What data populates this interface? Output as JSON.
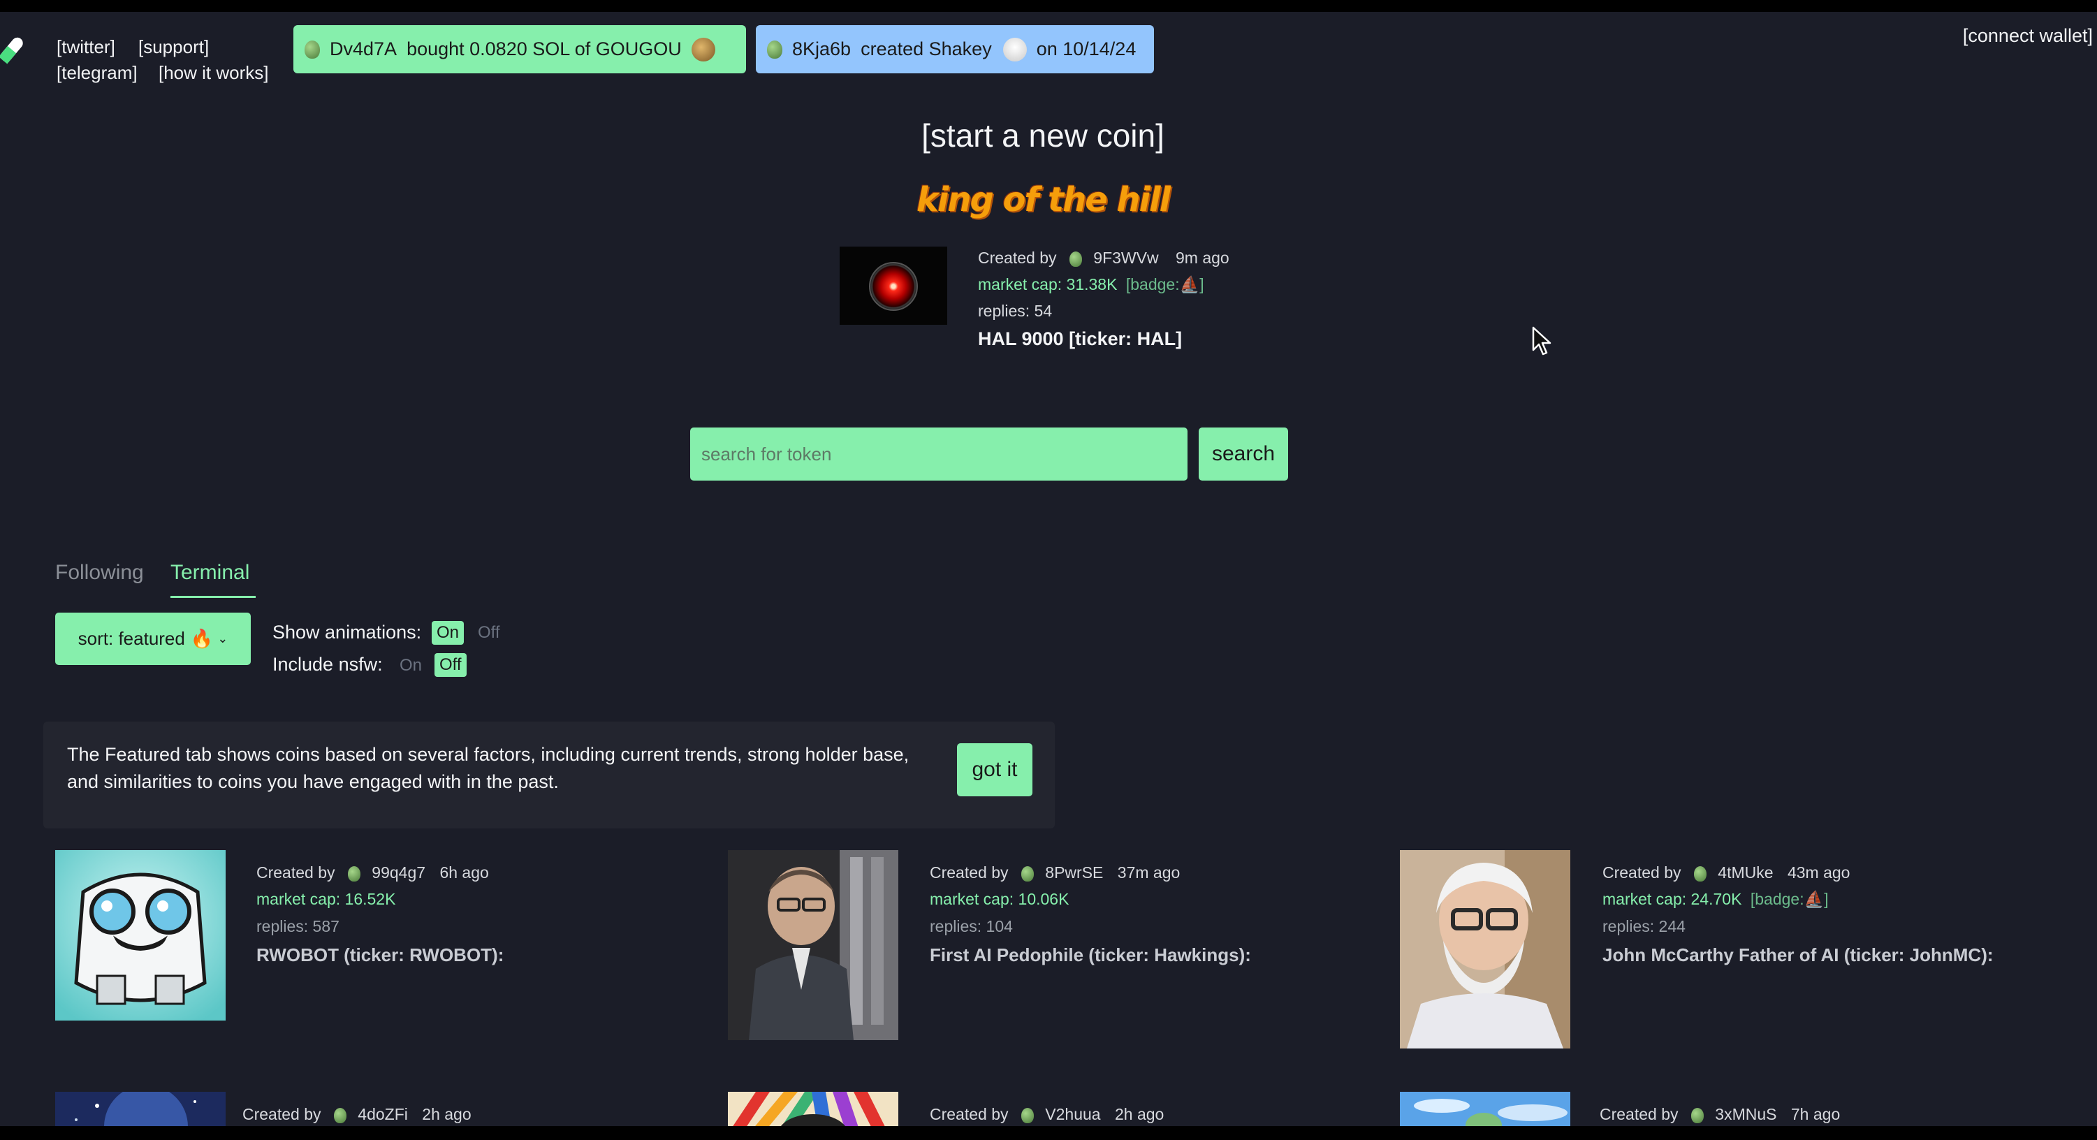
{
  "nav": {
    "twitter": "[twitter]",
    "support": "[support]",
    "telegram": "[telegram]",
    "how_it_works": "[how it works]",
    "connect_wallet": "[connect wallet]"
  },
  "ticker": {
    "buy": {
      "user": "Dv4d7A",
      "text": "bought 0.0820 SOL of GOUGOU"
    },
    "create": {
      "user": "8Kja6b",
      "text": "created Shakey",
      "date": "on 10/14/24"
    }
  },
  "hero": {
    "start_coin": "[start a new coin]",
    "king_of_the_hill": "king of the hill",
    "created_by": "Created by",
    "creator": "9F3WVw",
    "age": "9m ago",
    "market_cap": "market cap: 31.38K",
    "badge": "[badge:",
    "badge_end": "]",
    "replies": "replies: 54",
    "name": "HAL 9000 [ticker: HAL]"
  },
  "search": {
    "placeholder": "search for token",
    "button": "search"
  },
  "tabs": {
    "following": "Following",
    "terminal": "Terminal"
  },
  "controls": {
    "sort": "sort: featured",
    "show_animations": "Show animations:",
    "include_nsfw": "Include nsfw:",
    "on": "On",
    "off": "Off"
  },
  "notice": {
    "text": "The Featured tab shows coins based on several factors, including current trends, strong holder base, and similarities to coins you have engaged with in the past.",
    "button": "got it"
  },
  "coins": [
    {
      "created_by": "Created by",
      "creator": "99q4g7",
      "age": "6h ago",
      "market_cap": "market cap: 16.52K",
      "badge": "",
      "replies": "replies: 587",
      "name": "RWOBOT (ticker: RWOBOT):"
    },
    {
      "created_by": "Created by",
      "creator": "8PwrSE",
      "age": "37m ago",
      "market_cap": "market cap: 10.06K",
      "badge": "",
      "replies": "replies: 104",
      "name": "First AI Pedophile (ticker: Hawkings):"
    },
    {
      "created_by": "Created by",
      "creator": "4tMUke",
      "age": "43m ago",
      "market_cap": "market cap: 24.70K",
      "badge": "[badge:",
      "replies": "replies: 244",
      "name": "John McCarthy Father of AI (ticker: JohnMC):"
    },
    {
      "created_by": "Created by",
      "creator": "4doZFi",
      "age": "2h ago"
    },
    {
      "created_by": "Created by",
      "creator": "V2huua",
      "age": "2h ago"
    },
    {
      "created_by": "Created by",
      "creator": "3xMNuS",
      "age": "7h ago"
    }
  ],
  "colors": {
    "accent_green": "#86efac",
    "accent_blue": "#93c5fd",
    "background": "#1b1d28"
  }
}
